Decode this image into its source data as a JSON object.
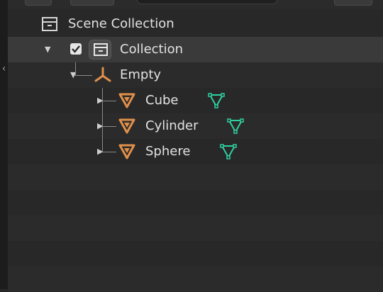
{
  "outliner": {
    "scene_collection": {
      "label": "Scene Collection",
      "icon": "scene-collection-icon"
    },
    "collection": {
      "label": "Collection",
      "checked": true,
      "icon": "collection-icon"
    },
    "empty": {
      "label": "Empty",
      "icon": "empty-object-icon"
    },
    "children": [
      {
        "label": "Cube",
        "icon": "mesh-object-icon",
        "data_icon": "mesh-data-icon"
      },
      {
        "label": "Cylinder",
        "icon": "mesh-object-icon",
        "data_icon": "mesh-data-icon"
      },
      {
        "label": "Sphere",
        "icon": "mesh-object-icon",
        "data_icon": "mesh-data-icon"
      }
    ]
  },
  "colors": {
    "background": "#282828",
    "row_alt": "#2b2b2b",
    "selected_row": "#3a3a3a",
    "object_icon": "#e0904a",
    "mesh_data_icon": "#2fd0a0",
    "text": "#e2e2e2"
  }
}
